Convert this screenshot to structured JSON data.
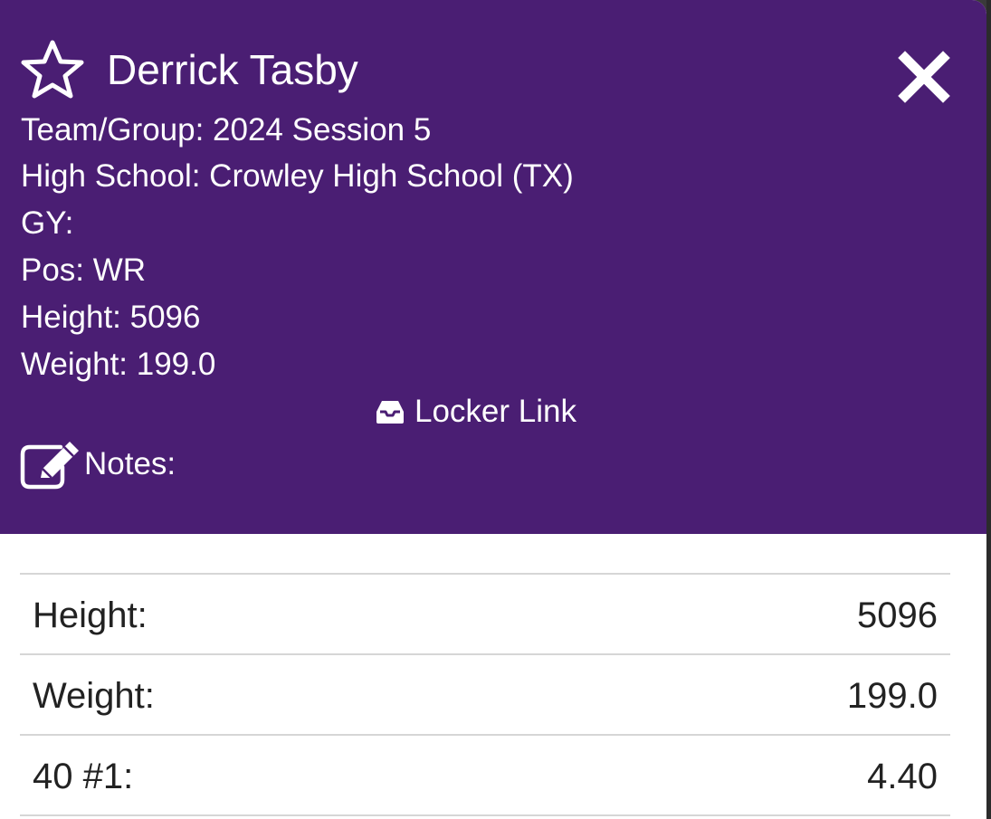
{
  "colors": {
    "header_bg": "#4a1e73",
    "header_text": "#ffffff",
    "table_text": "#222222",
    "row_divider": "#d6d6d6"
  },
  "header": {
    "favorite_icon": "star-outline-icon",
    "player_name": "Derrick Tasby",
    "close_icon": "close-x-icon",
    "info_lines": {
      "team_group": "Team/Group: 2024 Session 5",
      "high_school": "High School: Crowley High School (TX)",
      "gy": "GY:",
      "position": "Pos: WR",
      "height": "Height: 5096",
      "weight": "Weight: 199.0"
    },
    "locker_link": {
      "icon": "inbox-icon",
      "label": "Locker Link"
    },
    "notes": {
      "icon": "edit-note-icon",
      "label": "Notes:"
    }
  },
  "stats": [
    {
      "label": "Height:",
      "value": "5096"
    },
    {
      "label": "Weight:",
      "value": "199.0"
    },
    {
      "label": "40 #1:",
      "value": "4.40"
    }
  ]
}
